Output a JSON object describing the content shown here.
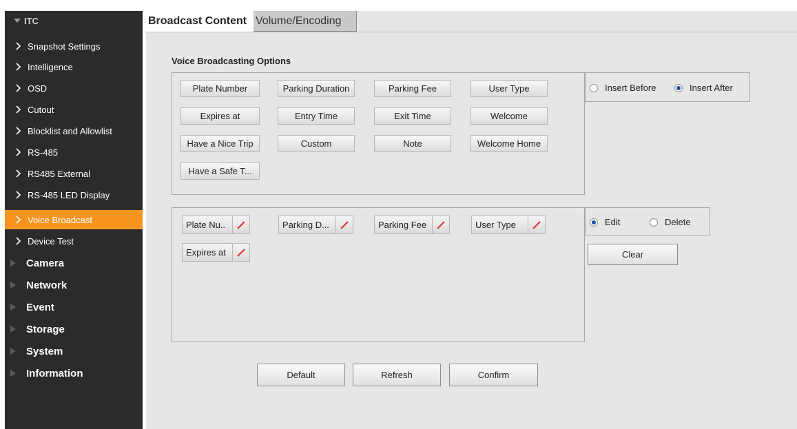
{
  "sidebar": {
    "section": "ITC",
    "sub_items": [
      {
        "label": "Snapshot Settings"
      },
      {
        "label": "Intelligence"
      },
      {
        "label": "OSD"
      },
      {
        "label": "Cutout"
      },
      {
        "label": "Blocklist and Allowlist"
      },
      {
        "label": "RS-485"
      },
      {
        "label": "RS485 External"
      },
      {
        "label": "RS-485 LED Display"
      },
      {
        "label": "Voice Broadcast",
        "active": true
      },
      {
        "label": "Device Test"
      }
    ],
    "top_items": [
      {
        "label": "Camera"
      },
      {
        "label": "Network"
      },
      {
        "label": "Event"
      },
      {
        "label": "Storage"
      },
      {
        "label": "System"
      },
      {
        "label": "Information"
      }
    ]
  },
  "tabs": {
    "broadcast_content": "Broadcast Content",
    "volume_encoding": "Volume/Encoding"
  },
  "options": {
    "title": "Voice Broadcasting Options",
    "buttons": [
      "Plate Number",
      "Parking Duration",
      "Parking Fee",
      "User Type",
      "Expires at",
      "Entry Time",
      "Exit Time",
      "Welcome",
      "Have a Nice Trip",
      "Custom",
      "Note",
      "Welcome Home",
      "Have a Safe T..."
    ],
    "insert_before": "Insert Before",
    "insert_after": "Insert After",
    "insert_selected": "Insert After"
  },
  "selected": {
    "chips": [
      "Plate Nu..",
      "Parking D...",
      "Parking Fee",
      "User Type",
      "Expires at"
    ],
    "edit_label": "Edit",
    "delete_label": "Delete",
    "mode_selected": "Edit",
    "clear_label": "Clear"
  },
  "actions": {
    "default": "Default",
    "refresh": "Refresh",
    "confirm": "Confirm"
  },
  "colors": {
    "sidebar_bg": "#2b2b2b",
    "active_item": "#f7941e",
    "content_bg": "#e6e6e6",
    "edit_icon": "#e0303a"
  }
}
